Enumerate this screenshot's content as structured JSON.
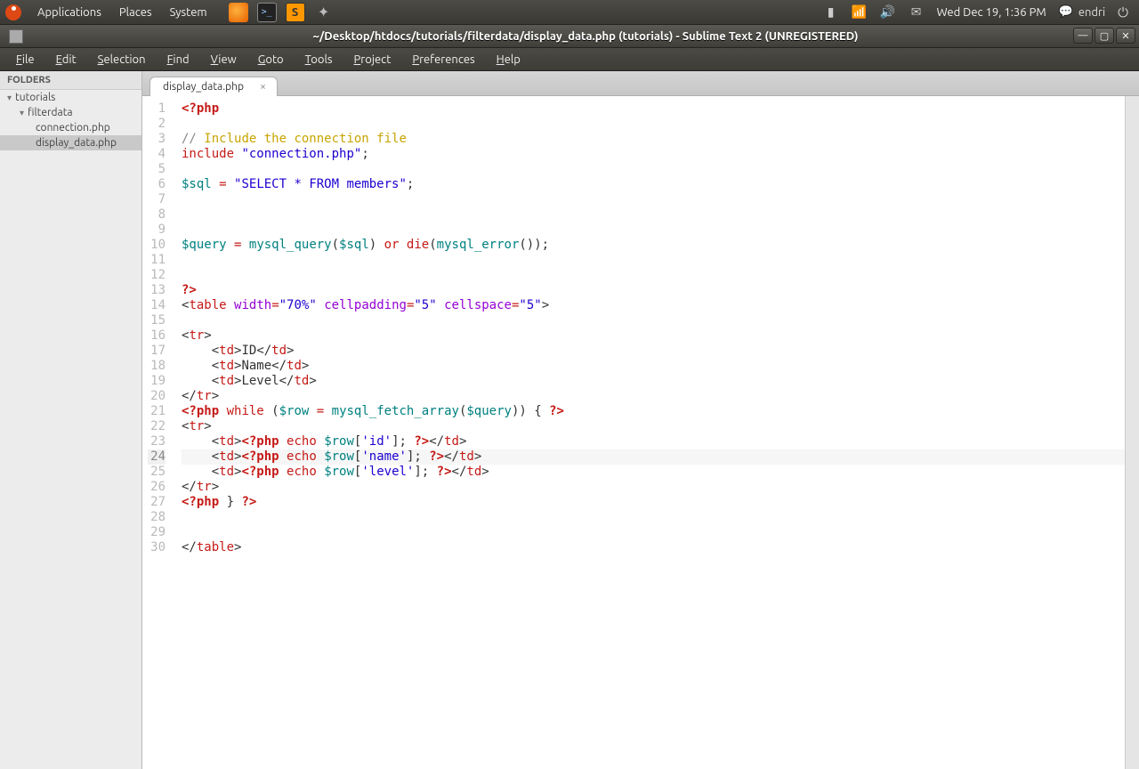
{
  "panel": {
    "menus": [
      "Applications",
      "Places",
      "System"
    ],
    "clock": "Wed Dec 19,  1:36 PM",
    "user": "endri"
  },
  "window": {
    "title": "~/Desktop/htdocs/tutorials/filterdata/display_data.php (tutorials) - Sublime Text 2 (UNREGISTERED)"
  },
  "menubar": [
    "File",
    "Edit",
    "Selection",
    "Find",
    "View",
    "Goto",
    "Tools",
    "Project",
    "Preferences",
    "Help"
  ],
  "sidebar": {
    "header": "FOLDERS",
    "items": [
      {
        "label": "tutorials",
        "depth": 0,
        "expanded": true
      },
      {
        "label": "filterdata",
        "depth": 1,
        "expanded": true
      },
      {
        "label": "connection.php",
        "depth": 2,
        "expanded": false
      },
      {
        "label": "display_data.php",
        "depth": 2,
        "expanded": false,
        "selected": true
      }
    ]
  },
  "tab": {
    "label": "display_data.php"
  },
  "current_line": 24,
  "code": [
    {
      "n": 1,
      "tokens": [
        {
          "c": "kw",
          "t": "<?php"
        }
      ]
    },
    {
      "n": 2,
      "tokens": []
    },
    {
      "n": 3,
      "tokens": [
        {
          "c": "cmt",
          "t": "// "
        },
        {
          "c": "cmt2",
          "t": "Include the connection file"
        }
      ]
    },
    {
      "n": 4,
      "tokens": [
        {
          "c": "kw2",
          "t": "include"
        },
        {
          "c": "txt",
          "t": " "
        },
        {
          "c": "str",
          "t": "\"connection.php\""
        },
        {
          "c": "txt",
          "t": ";"
        }
      ]
    },
    {
      "n": 5,
      "tokens": []
    },
    {
      "n": 6,
      "tokens": [
        {
          "c": "var",
          "t": "$sql"
        },
        {
          "c": "txt",
          "t": " "
        },
        {
          "c": "op",
          "t": "="
        },
        {
          "c": "txt",
          "t": " "
        },
        {
          "c": "str",
          "t": "\"SELECT * FROM members\""
        },
        {
          "c": "txt",
          "t": ";"
        }
      ]
    },
    {
      "n": 7,
      "tokens": []
    },
    {
      "n": 8,
      "tokens": []
    },
    {
      "n": 9,
      "tokens": []
    },
    {
      "n": 10,
      "tokens": [
        {
          "c": "var",
          "t": "$query"
        },
        {
          "c": "txt",
          "t": " "
        },
        {
          "c": "op",
          "t": "="
        },
        {
          "c": "txt",
          "t": " "
        },
        {
          "c": "fn",
          "t": "mysql_query"
        },
        {
          "c": "txt",
          "t": "("
        },
        {
          "c": "var",
          "t": "$sql"
        },
        {
          "c": "txt",
          "t": ") "
        },
        {
          "c": "kw2",
          "t": "or"
        },
        {
          "c": "txt",
          "t": " "
        },
        {
          "c": "kw2",
          "t": "die"
        },
        {
          "c": "txt",
          "t": "("
        },
        {
          "c": "fn",
          "t": "mysql_error"
        },
        {
          "c": "txt",
          "t": "());"
        }
      ]
    },
    {
      "n": 11,
      "tokens": []
    },
    {
      "n": 12,
      "tokens": []
    },
    {
      "n": 13,
      "tokens": [
        {
          "c": "kw",
          "t": "?>"
        }
      ]
    },
    {
      "n": 14,
      "tokens": [
        {
          "c": "tagb",
          "t": "<"
        },
        {
          "c": "tagn",
          "t": "table"
        },
        {
          "c": "txt",
          "t": " "
        },
        {
          "c": "attr",
          "t": "width"
        },
        {
          "c": "op",
          "t": "="
        },
        {
          "c": "str",
          "t": "\"70%\""
        },
        {
          "c": "txt",
          "t": " "
        },
        {
          "c": "attr",
          "t": "cellpadding"
        },
        {
          "c": "op",
          "t": "="
        },
        {
          "c": "str",
          "t": "\"5\""
        },
        {
          "c": "txt",
          "t": " "
        },
        {
          "c": "attr",
          "t": "cellspace"
        },
        {
          "c": "op",
          "t": "="
        },
        {
          "c": "str",
          "t": "\"5\""
        },
        {
          "c": "tagb",
          "t": ">"
        }
      ]
    },
    {
      "n": 15,
      "tokens": []
    },
    {
      "n": 16,
      "tokens": [
        {
          "c": "tagb",
          "t": "<"
        },
        {
          "c": "tagn",
          "t": "tr"
        },
        {
          "c": "tagb",
          "t": ">"
        }
      ]
    },
    {
      "n": 17,
      "tokens": [
        {
          "c": "txt",
          "t": "    "
        },
        {
          "c": "tagb",
          "t": "<"
        },
        {
          "c": "tagn",
          "t": "td"
        },
        {
          "c": "tagb",
          "t": ">"
        },
        {
          "c": "txt",
          "t": "ID"
        },
        {
          "c": "tagb",
          "t": "</"
        },
        {
          "c": "tagn",
          "t": "td"
        },
        {
          "c": "tagb",
          "t": ">"
        }
      ]
    },
    {
      "n": 18,
      "tokens": [
        {
          "c": "txt",
          "t": "    "
        },
        {
          "c": "tagb",
          "t": "<"
        },
        {
          "c": "tagn",
          "t": "td"
        },
        {
          "c": "tagb",
          "t": ">"
        },
        {
          "c": "txt",
          "t": "Name"
        },
        {
          "c": "tagb",
          "t": "</"
        },
        {
          "c": "tagn",
          "t": "td"
        },
        {
          "c": "tagb",
          "t": ">"
        }
      ]
    },
    {
      "n": 19,
      "tokens": [
        {
          "c": "txt",
          "t": "    "
        },
        {
          "c": "tagb",
          "t": "<"
        },
        {
          "c": "tagn",
          "t": "td"
        },
        {
          "c": "tagb",
          "t": ">"
        },
        {
          "c": "txt",
          "t": "Level"
        },
        {
          "c": "tagb",
          "t": "</"
        },
        {
          "c": "tagn",
          "t": "td"
        },
        {
          "c": "tagb",
          "t": ">"
        }
      ]
    },
    {
      "n": 20,
      "tokens": [
        {
          "c": "tagb",
          "t": "</"
        },
        {
          "c": "tagn",
          "t": "tr"
        },
        {
          "c": "tagb",
          "t": ">"
        }
      ]
    },
    {
      "n": 21,
      "tokens": [
        {
          "c": "kw",
          "t": "<?php"
        },
        {
          "c": "txt",
          "t": " "
        },
        {
          "c": "kw2",
          "t": "while"
        },
        {
          "c": "txt",
          "t": " ("
        },
        {
          "c": "var",
          "t": "$row"
        },
        {
          "c": "txt",
          "t": " "
        },
        {
          "c": "op",
          "t": "="
        },
        {
          "c": "txt",
          "t": " "
        },
        {
          "c": "fn",
          "t": "mysql_fetch_array"
        },
        {
          "c": "txt",
          "t": "("
        },
        {
          "c": "var",
          "t": "$query"
        },
        {
          "c": "txt",
          "t": ")) { "
        },
        {
          "c": "kw",
          "t": "?>"
        }
      ]
    },
    {
      "n": 22,
      "tokens": [
        {
          "c": "tagb",
          "t": "<"
        },
        {
          "c": "tagn",
          "t": "tr"
        },
        {
          "c": "tagb",
          "t": ">"
        }
      ]
    },
    {
      "n": 23,
      "tokens": [
        {
          "c": "txt",
          "t": "    "
        },
        {
          "c": "tagb",
          "t": "<"
        },
        {
          "c": "tagn",
          "t": "td"
        },
        {
          "c": "tagb",
          "t": ">"
        },
        {
          "c": "kw",
          "t": "<?php"
        },
        {
          "c": "txt",
          "t": " "
        },
        {
          "c": "kw2",
          "t": "echo"
        },
        {
          "c": "txt",
          "t": " "
        },
        {
          "c": "var",
          "t": "$row"
        },
        {
          "c": "txt",
          "t": "["
        },
        {
          "c": "str",
          "t": "'id'"
        },
        {
          "c": "txt",
          "t": "]; "
        },
        {
          "c": "kw",
          "t": "?>"
        },
        {
          "c": "tagb",
          "t": "</"
        },
        {
          "c": "tagn",
          "t": "td"
        },
        {
          "c": "tagb",
          "t": ">"
        }
      ]
    },
    {
      "n": 24,
      "tokens": [
        {
          "c": "txt",
          "t": "    "
        },
        {
          "c": "tagb",
          "t": "<"
        },
        {
          "c": "tagn",
          "t": "td"
        },
        {
          "c": "tagb",
          "t": ">"
        },
        {
          "c": "kw",
          "t": "<?php"
        },
        {
          "c": "txt",
          "t": " "
        },
        {
          "c": "kw2",
          "t": "echo"
        },
        {
          "c": "txt",
          "t": " "
        },
        {
          "c": "var",
          "t": "$row"
        },
        {
          "c": "txt",
          "t": "["
        },
        {
          "c": "str",
          "t": "'name'"
        },
        {
          "c": "txt",
          "t": "]; "
        },
        {
          "c": "kw",
          "t": "?>"
        },
        {
          "c": "tagb",
          "t": "</"
        },
        {
          "c": "tagn",
          "t": "td"
        },
        {
          "c": "tagb",
          "t": ">"
        }
      ]
    },
    {
      "n": 25,
      "tokens": [
        {
          "c": "txt",
          "t": "    "
        },
        {
          "c": "tagb",
          "t": "<"
        },
        {
          "c": "tagn",
          "t": "td"
        },
        {
          "c": "tagb",
          "t": ">"
        },
        {
          "c": "kw",
          "t": "<?php"
        },
        {
          "c": "txt",
          "t": " "
        },
        {
          "c": "kw2",
          "t": "echo"
        },
        {
          "c": "txt",
          "t": " "
        },
        {
          "c": "var",
          "t": "$row"
        },
        {
          "c": "txt",
          "t": "["
        },
        {
          "c": "str",
          "t": "'level'"
        },
        {
          "c": "txt",
          "t": "]; "
        },
        {
          "c": "kw",
          "t": "?>"
        },
        {
          "c": "tagb",
          "t": "</"
        },
        {
          "c": "tagn",
          "t": "td"
        },
        {
          "c": "tagb",
          "t": ">"
        }
      ]
    },
    {
      "n": 26,
      "tokens": [
        {
          "c": "tagb",
          "t": "</"
        },
        {
          "c": "tagn",
          "t": "tr"
        },
        {
          "c": "tagb",
          "t": ">"
        }
      ]
    },
    {
      "n": 27,
      "tokens": [
        {
          "c": "kw",
          "t": "<?php"
        },
        {
          "c": "txt",
          "t": " } "
        },
        {
          "c": "kw",
          "t": "?>"
        }
      ]
    },
    {
      "n": 28,
      "tokens": []
    },
    {
      "n": 29,
      "tokens": []
    },
    {
      "n": 30,
      "tokens": [
        {
          "c": "tagb",
          "t": "</"
        },
        {
          "c": "tagn",
          "t": "table"
        },
        {
          "c": "tagb",
          "t": ">"
        }
      ]
    }
  ]
}
